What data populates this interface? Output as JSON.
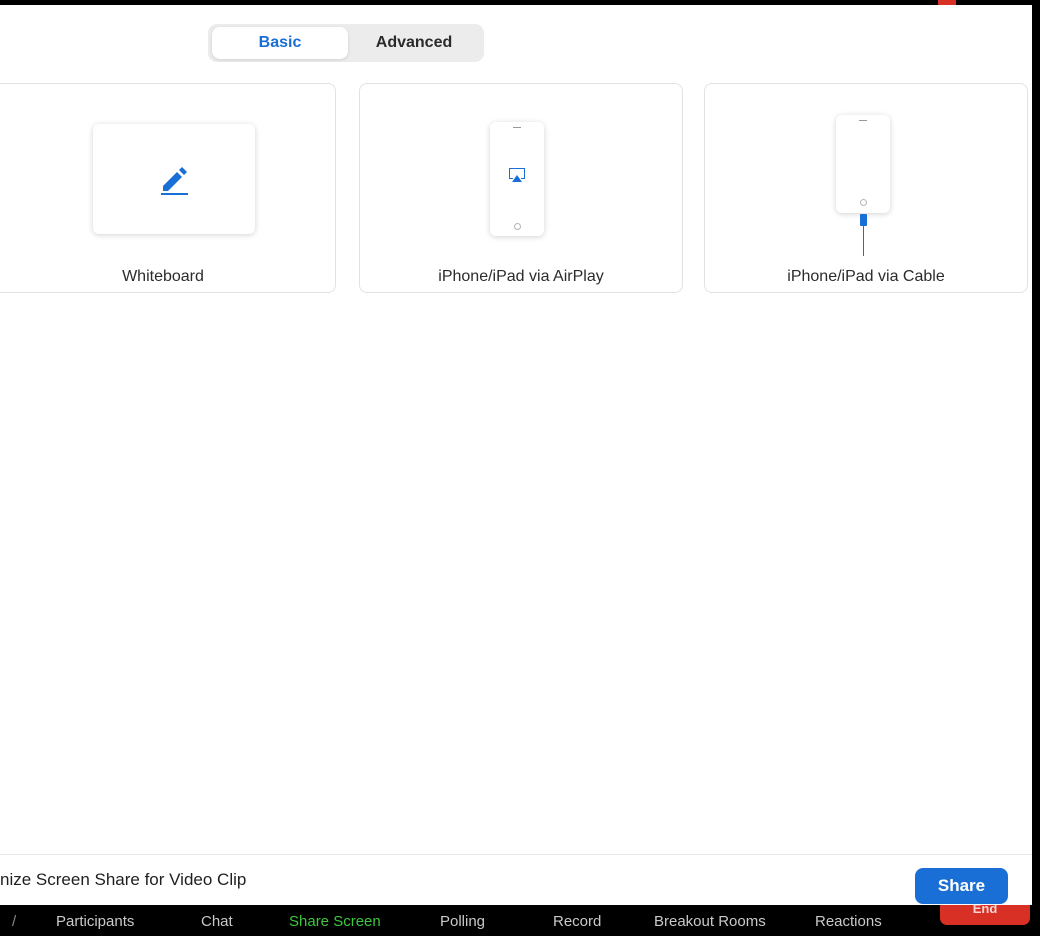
{
  "tabs": {
    "basic": "Basic",
    "advanced": "Advanced"
  },
  "share_options": [
    {
      "label": "Whiteboard",
      "icon": "pencil-icon"
    },
    {
      "label": "iPhone/iPad via AirPlay",
      "icon": "airplay-icon"
    },
    {
      "label": "iPhone/iPad via Cable",
      "icon": "cable-icon"
    }
  ],
  "footer": {
    "option_label": "nize Screen Share for Video Clip",
    "share_button": "Share"
  },
  "meeting_toolbar": {
    "items": [
      "Participants",
      "Chat",
      "Share Screen",
      "Polling",
      "Record",
      "Breakout Rooms",
      "Reactions"
    ],
    "active_item": "Share Screen",
    "end_button": "End"
  },
  "colors": {
    "accent": "#1a6fd6",
    "active_toolbar": "#3cc73c",
    "end_red": "#d93025"
  }
}
